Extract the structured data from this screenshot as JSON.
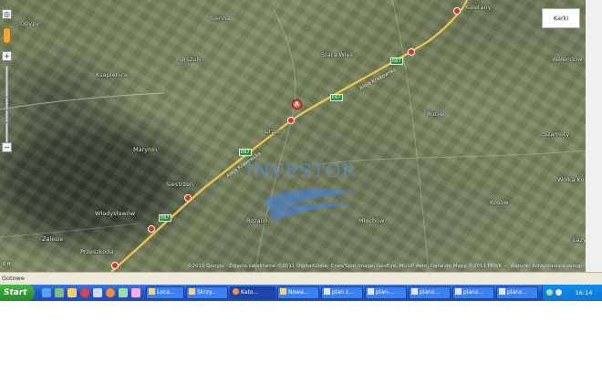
{
  "map": {
    "places": [
      {
        "name": "Opypy"
      },
      {
        "name": "Stara Wieś"
      },
      {
        "name": "Kaletany"
      },
      {
        "name": "Walendów"
      },
      {
        "name": "Ksaplenice"
      },
      {
        "name": "Ruciec"
      },
      {
        "name": "Urszulin"
      },
      {
        "name": "Marynin"
      },
      {
        "name": "Szamoty"
      },
      {
        "name": "Wólka Kosowska"
      },
      {
        "name": "Łazy"
      },
      {
        "name": "Władysławów"
      },
      {
        "name": "Siestrzeń"
      },
      {
        "name": "Rozalin"
      },
      {
        "name": "Młochów"
      },
      {
        "name": "Kosów"
      },
      {
        "name": "Zalesie"
      },
      {
        "name": "Przeszkoda"
      },
      {
        "name": "Sienna"
      },
      {
        "name": "Urzut"
      }
    ],
    "roads": {
      "s_label": "8",
      "e_label": "E67",
      "road_name": "Aleja Krakowska"
    },
    "marker_label": "A",
    "watermark": "INVESTOR",
    "map_type_button": "Karki",
    "scale_text": "0 ft",
    "attribution": "©2011 Google · Zdjęcia satelitarne ©2011 DigitalGlobe, Cnes/Spot Image, GeoEye, MGGP Aero, Dane do Mapy ©2011 PPWK — Warunki korzystania z usługi"
  },
  "browser": {
    "status_text": "Gotowe"
  },
  "taskbar": {
    "start_label": "Start",
    "tasks": [
      {
        "label": "Loca..."
      },
      {
        "label": "Skrzy..."
      },
      {
        "label": "Kato..."
      },
      {
        "label": "Nowa..."
      },
      {
        "label": "plan z..."
      },
      {
        "label": "plan-..."
      },
      {
        "label": "planz..."
      },
      {
        "label": "planz..."
      },
      {
        "label": "planz..."
      }
    ],
    "clock": "16:14"
  },
  "colors": {
    "highway": "#f2c84a",
    "road_shield": "#d8322a",
    "euro_badge": "#2e8b3a",
    "taskbar_blue": "#2456c6",
    "start_green": "#2f9a2f"
  }
}
